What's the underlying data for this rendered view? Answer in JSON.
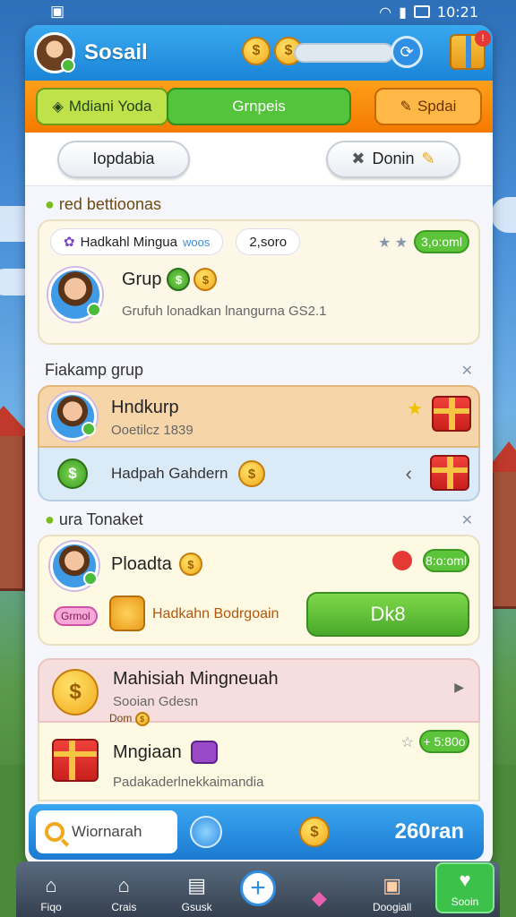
{
  "status_bar": {
    "time": "10:21"
  },
  "header": {
    "title": "Sosail",
    "coin_symbol": "$",
    "refresh_glyph": "⟳"
  },
  "tabs": [
    {
      "label": "Mdiani Yoda"
    },
    {
      "label": "Grnpeis"
    },
    {
      "label": "Spdai"
    }
  ],
  "subbar": {
    "left_button": "Iopdabia",
    "right_button": "Donin"
  },
  "section1": {
    "title": "red bettioonas",
    "top_pill": "Hadkahl Mingua",
    "top_pill_suffix": "woos",
    "count_pill": "2,soro",
    "green_pill": "3,o:oml",
    "name": "Grup",
    "subtitle": "Grufuh lonadkan lnangurna GS2.1"
  },
  "section2": {
    "title": "Fiakamp grup",
    "item1": {
      "name": "Hndkurp",
      "sub": "Ooetilcz 1839"
    },
    "item2": {
      "label": "Hadpah Gahdern"
    }
  },
  "section3": {
    "title": "ura Tonaket",
    "name": "Ploadta",
    "green_pill": "8:o:oml",
    "pink_tag": "Grmol",
    "offer_text": "Hadkahn Bodrgoain",
    "cta_button": "Dk8"
  },
  "section4": {
    "item1": {
      "name": "Mahisiah Mingneuah",
      "sub": "Sooian Gdesn"
    },
    "mini_label": "Dom",
    "item2": {
      "name": "Mngiaan",
      "sub": "Padakaderlnekkaimandia",
      "green_pill": "+ 5:80o"
    }
  },
  "bottom_search": {
    "placeholder": "Wiornarah",
    "amount": "260ran"
  },
  "nav": [
    {
      "label": "Fiqo",
      "icon": "home-icon"
    },
    {
      "label": "Crais",
      "icon": "house-icon"
    },
    {
      "label": "Gsusk",
      "icon": "map-icon"
    },
    {
      "label": "",
      "icon": "plus-icon"
    },
    {
      "label": "",
      "icon": "ticket-icon"
    },
    {
      "label": "Doogiall",
      "icon": "chest-icon"
    },
    {
      "label": "Sooin",
      "icon": "heart-icon"
    }
  ]
}
